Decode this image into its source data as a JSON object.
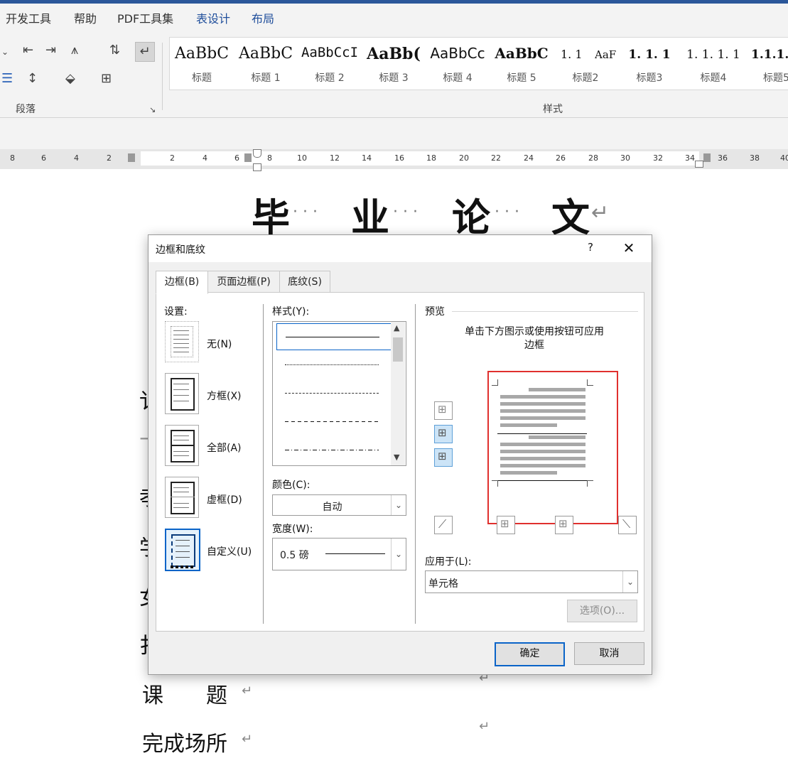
{
  "ribbon": {
    "tabs": [
      "开发工具",
      "帮助",
      "PDF工具集",
      "表设计",
      "布局"
    ],
    "group_paragraph": "段落",
    "group_styles": "样式",
    "styles": [
      {
        "preview": "AaBbC",
        "name": "标题"
      },
      {
        "preview": "AaBbC",
        "name": "标题 1"
      },
      {
        "preview": "AaBbCcI",
        "name": "标题 2"
      },
      {
        "preview": "AaBb(",
        "name": "标题 3"
      },
      {
        "preview": "AaBbCc",
        "name": "标题 4"
      },
      {
        "preview": "AaBbC",
        "name": "标题 5"
      },
      {
        "preview": "1. 1",
        "name": "标题2"
      },
      {
        "preview": "1. 1. 1",
        "name": "标题3"
      },
      {
        "preview": "1. 1. 1. 1",
        "name": "标题4"
      },
      {
        "preview": "1.1.1.",
        "name": "标题5"
      }
    ],
    "style_extra_preview": "AaF"
  },
  "ruler": {
    "left_numbers": [
      "8",
      "6",
      "4",
      "2"
    ],
    "right_numbers": [
      "2",
      "4",
      "6",
      "8",
      "10",
      "12",
      "14",
      "16",
      "18",
      "20",
      "22",
      "24",
      "26",
      "28",
      "30",
      "32",
      "34",
      "36",
      "38",
      "40"
    ]
  },
  "document": {
    "title_chars": [
      "毕",
      "业",
      "论",
      "文"
    ],
    "partial_chars": [
      "讠",
      "亠",
      "孝",
      "学",
      "女",
      "扌"
    ],
    "line_course": "课　　题",
    "line_place": "完成场所"
  },
  "dialog": {
    "title": "边框和底纹",
    "help": "?",
    "close": "✕",
    "tabs": [
      "边框(B)",
      "页面边框(P)",
      "底纹(S)"
    ],
    "settings_label": "设置:",
    "settings": [
      "无(N)",
      "方框(X)",
      "全部(A)",
      "虚框(D)",
      "自定义(U)"
    ],
    "style_label": "样式(Y):",
    "color_label": "颜色(C):",
    "color_value": "自动",
    "width_label": "宽度(W):",
    "width_value": "0.5 磅",
    "preview_label": "预览",
    "preview_hint": "单击下方图示或使用按钮可应用边框",
    "apply_label": "应用于(L):",
    "apply_value": "单元格",
    "options_button": "选项(O)...",
    "ok_button": "确定",
    "cancel_button": "取消"
  }
}
